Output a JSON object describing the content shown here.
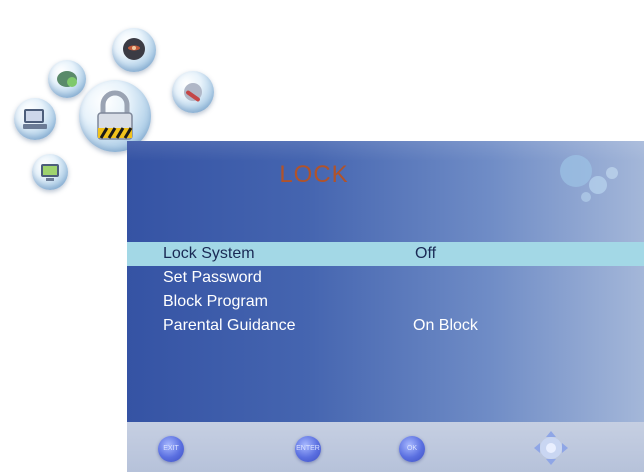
{
  "menu": {
    "title": "LOCK",
    "items": [
      {
        "label": "Lock System",
        "value": "Off",
        "selected": true
      },
      {
        "label": "Set Password",
        "value": ""
      },
      {
        "label": "Block Program",
        "value": ""
      },
      {
        "label": "Parental Guidance",
        "value": "On Block"
      }
    ]
  },
  "bottom_bar": {
    "buttons": [
      {
        "name": "exit-button",
        "text": "EXIT"
      },
      {
        "name": "enter-button",
        "text": "ENTER"
      },
      {
        "name": "ok-button",
        "text": "OK"
      }
    ]
  },
  "icons": {
    "cluster": [
      "picture-icon",
      "sound-icon",
      "settings-icon",
      "pc-icon",
      "lock-icon",
      "channel-icon"
    ],
    "corner": "bubbles-icon",
    "dpad": "dpad-icon"
  },
  "colors": {
    "title": "#b0532b",
    "selected_row": "#a3d8e6",
    "panel_left": "#3553a4",
    "panel_right": "#a4b7d9"
  }
}
